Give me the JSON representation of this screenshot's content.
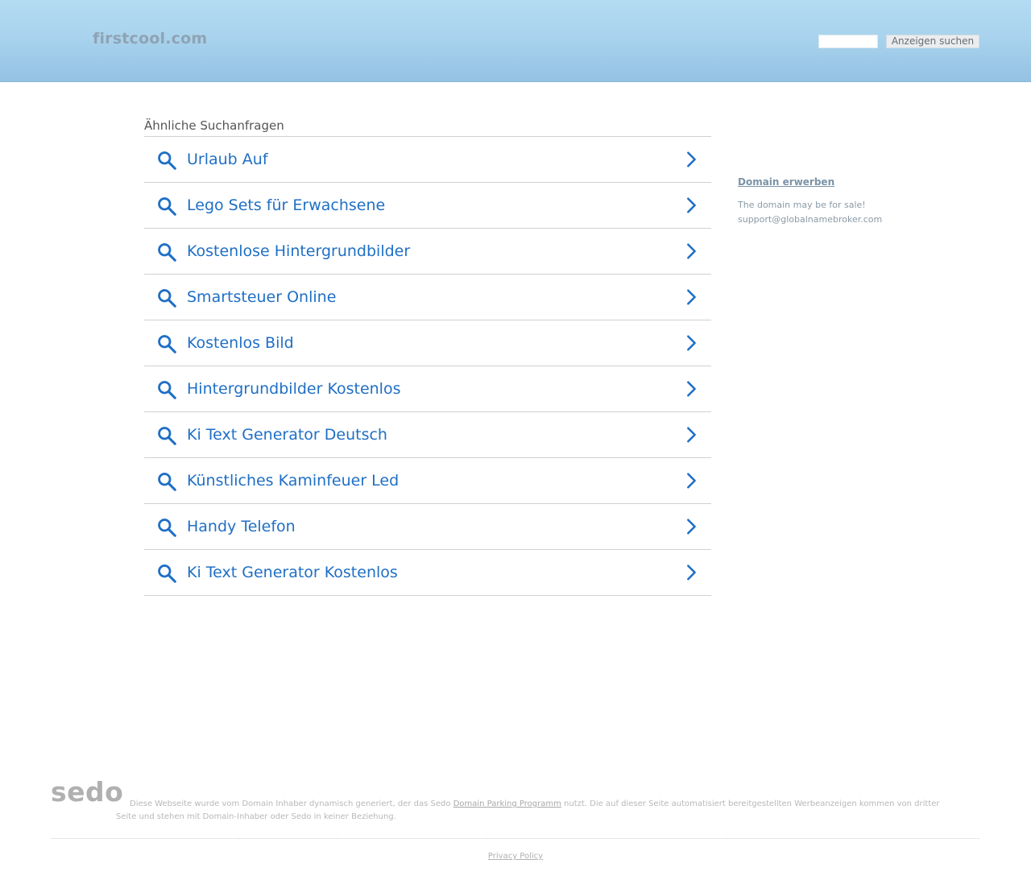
{
  "header": {
    "logo": "firstcool.com",
    "search_value": "",
    "search_button": "Anzeigen suchen"
  },
  "related": {
    "title": "Ähnliche Suchanfragen",
    "items": [
      "Urlaub Auf",
      "Lego Sets für Erwachsene",
      "Kostenlose Hintergrundbilder",
      "Smartsteuer Online",
      "Kostenlos Bild",
      "Hintergrundbilder Kostenlos",
      "Ki Text Generator Deutsch",
      "Künstliches Kaminfeuer Led",
      "Handy Telefon",
      "Ki Text Generator Kostenlos"
    ],
    "icon": "search-icon",
    "chevron": "chevron-right-icon",
    "link_color": "#1f6fc5"
  },
  "sidebar": {
    "domain_link": "Domain erwerben",
    "sale_line1": "The domain may be for sale!",
    "sale_line2": "support@globalnamebroker.com"
  },
  "footer": {
    "sedo_logo": "sedo",
    "disclaimer_part1": "Diese Webseite wurde vom Domain Inhaber dynamisch generiert, der das Sedo ",
    "disclaimer_link": "Domain Parking Programm",
    "disclaimer_part2": " nutzt. Die auf dieser Seite automatisiert bereitgestellten Werbeanzeigen kommen von dritter Seite und stehen mit Domain-Inhaber oder Sedo in keiner Beziehung.",
    "privacy": "Privacy Policy"
  }
}
